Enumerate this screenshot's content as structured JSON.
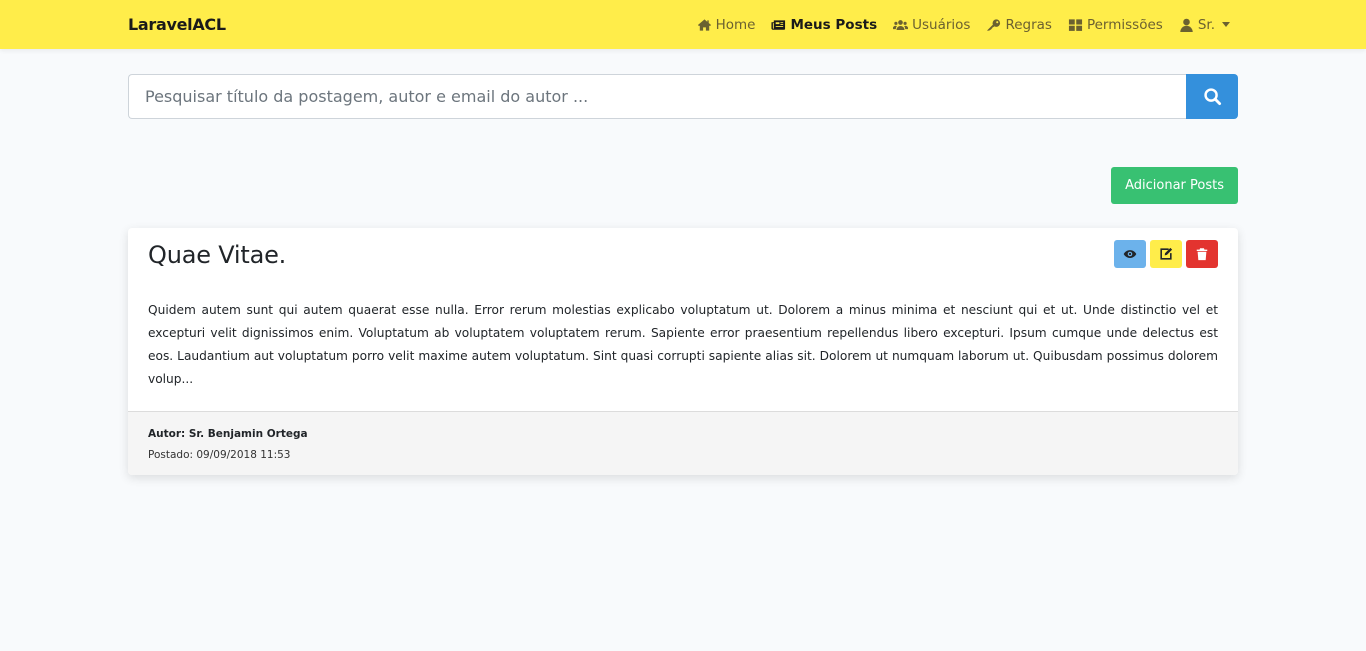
{
  "navbar": {
    "brand": "LaravelACL",
    "items": [
      {
        "label": "Home",
        "icon": "home-icon"
      },
      {
        "label": "Meus Posts",
        "icon": "newspaper-icon",
        "active": true
      },
      {
        "label": "Usuários",
        "icon": "users-icon"
      },
      {
        "label": "Regras",
        "icon": "key-icon"
      },
      {
        "label": "Permissões",
        "icon": "grid-icon"
      },
      {
        "label": "Sr.",
        "icon": "user-icon",
        "dropdown": true
      }
    ]
  },
  "search": {
    "placeholder": "Pesquisar título da postagem, autor e email do autor ...",
    "value": "",
    "button_icon": "search-icon"
  },
  "toolbar": {
    "add_label": "Adicionar Posts"
  },
  "post": {
    "title": "Quae Vitae.",
    "body": "Quidem autem sunt qui autem quaerat esse nulla. Error rerum molestias explicabo voluptatum ut. Dolorem a minus minima et nesciunt qui et ut. Unde distinctio vel et excepturi velit dignissimos enim. Voluptatum ab voluptatem voluptatem rerum. Sapiente error praesentium repellendus libero excepturi. Ipsum cumque unde delectus est eos. Laudantium aut voluptatum porro velit maxime autem voluptatum. Sint quasi corrupti sapiente alias sit. Dolorem ut numquam laborum ut. Quibusdam possimus dolorem volup...",
    "author": "Autor: Sr. Benjamin Ortega",
    "posted": "Postado: 09/09/2018 11:53",
    "actions": [
      "eye-icon",
      "edit-icon",
      "trash-icon"
    ]
  },
  "colors": {
    "navbar_bg": "#ffed4a",
    "primary": "#3490dc",
    "success": "#38c172",
    "info": "#6cb2eb",
    "warning": "#ffed4a",
    "danger": "#e3342f"
  }
}
